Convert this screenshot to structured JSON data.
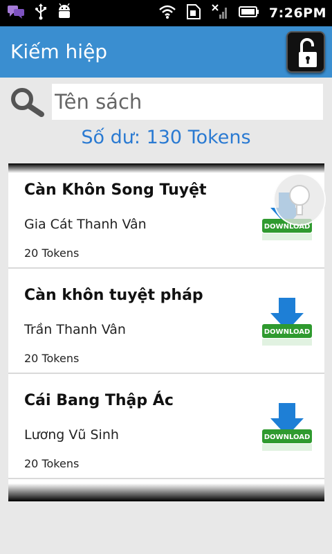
{
  "status_bar": {
    "time": "7:26PM",
    "icons": [
      "chat-icon",
      "usb-icon",
      "android-icon",
      "wifi-icon",
      "sim-icon",
      "signal-icon",
      "battery-icon"
    ]
  },
  "action_bar": {
    "title": "Kiếm hiệp",
    "lock_icon": "unlock-icon"
  },
  "search": {
    "placeholder": "Tên sách"
  },
  "balance": "Số dư: 130 Tokens",
  "books": [
    {
      "title": "Càn Khôn Song Tuyệt",
      "author": "Gia Cát Thanh Vân",
      "price": "20 Tokens",
      "action": "DOWNLOAD"
    },
    {
      "title": "Càn khôn tuyệt pháp",
      "author": "Trần Thanh Vân",
      "price": "20 Tokens",
      "action": "DOWNLOAD"
    },
    {
      "title": "Cái Bang Thập Ác",
      "author": "Lương Vũ Sinh",
      "price": "20 Tokens",
      "action": "DOWNLOAD"
    }
  ],
  "colors": {
    "action_bar": "#3a8ed0",
    "balance_text": "#2a7ad2",
    "download_green": "#2f9a2f",
    "download_arrow": "#1e7fd6"
  }
}
